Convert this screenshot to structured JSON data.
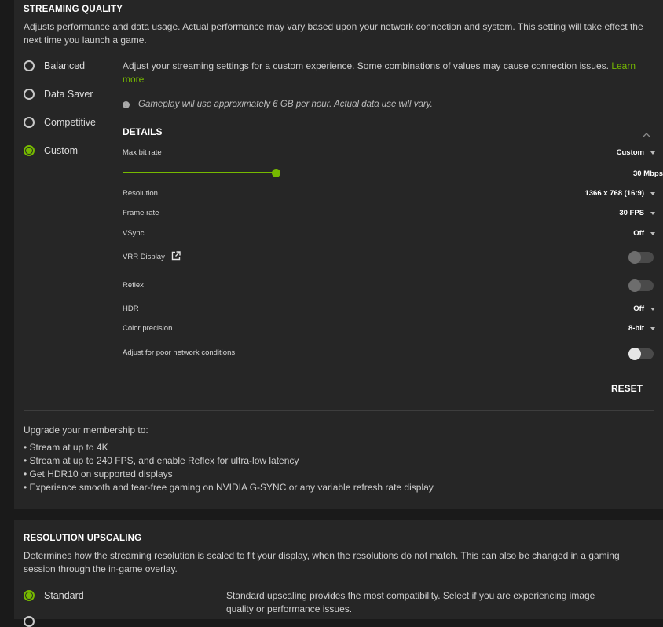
{
  "streaming_quality": {
    "title": "STREAMING QUALITY",
    "description": "Adjusts performance and data usage. Actual performance may vary based upon your network connection and system. This setting will take effect the next time you launch a game.",
    "options": [
      {
        "label": "Balanced",
        "selected": false
      },
      {
        "label": "Data Saver",
        "selected": false
      },
      {
        "label": "Competitive",
        "selected": false
      },
      {
        "label": "Custom",
        "selected": true
      }
    ],
    "custom_text": "Adjust your streaming settings for a custom experience. Some combinations of values may cause connection issues.",
    "learn_more": "Learn more",
    "info_text": "Gameplay will use approximately 6 GB per hour. Actual data use will vary.",
    "details_title": "DETAILS",
    "max_bit_rate": {
      "label": "Max bit rate",
      "value": "Custom",
      "slider_value": "30 Mbps",
      "slider_fraction": 0.36
    },
    "resolution": {
      "label": "Resolution",
      "value": "1366 x 768 (16:9)"
    },
    "frame_rate": {
      "label": "Frame rate",
      "value": "30 FPS"
    },
    "vsync": {
      "label": "VSync",
      "value": "Off"
    },
    "vrr_display": {
      "label": "VRR Display",
      "on": false
    },
    "reflex": {
      "label": "Reflex",
      "on": false
    },
    "hdr": {
      "label": "HDR",
      "value": "Off"
    },
    "color_precision": {
      "label": "Color precision",
      "value": "8-bit"
    },
    "poor_network": {
      "label": "Adjust for poor network conditions",
      "on": false
    },
    "reset_label": "RESET",
    "upgrade_title": "Upgrade your membership to:",
    "upgrade_items": [
      "• Stream at up to 4K",
      "• Stream at up to 240 FPS, and enable Reflex for ultra-low latency",
      "• Get HDR10 on supported displays",
      "• Experience smooth and tear-free gaming on NVIDIA G-SYNC or any variable refresh rate display"
    ]
  },
  "resolution_upscaling": {
    "title": "RESOLUTION UPSCALING",
    "description": "Determines how the streaming resolution is scaled to fit your display, when the resolutions do not match. This can also be changed in a gaming session through the in-game overlay.",
    "option": {
      "label": "Standard",
      "selected": true
    },
    "option_text": "Standard upscaling provides the most compatibility. Select if you are experiencing image quality or performance issues."
  },
  "colors": {
    "accent": "#76b900",
    "panel": "#262626",
    "background": "#1a1a1a"
  }
}
